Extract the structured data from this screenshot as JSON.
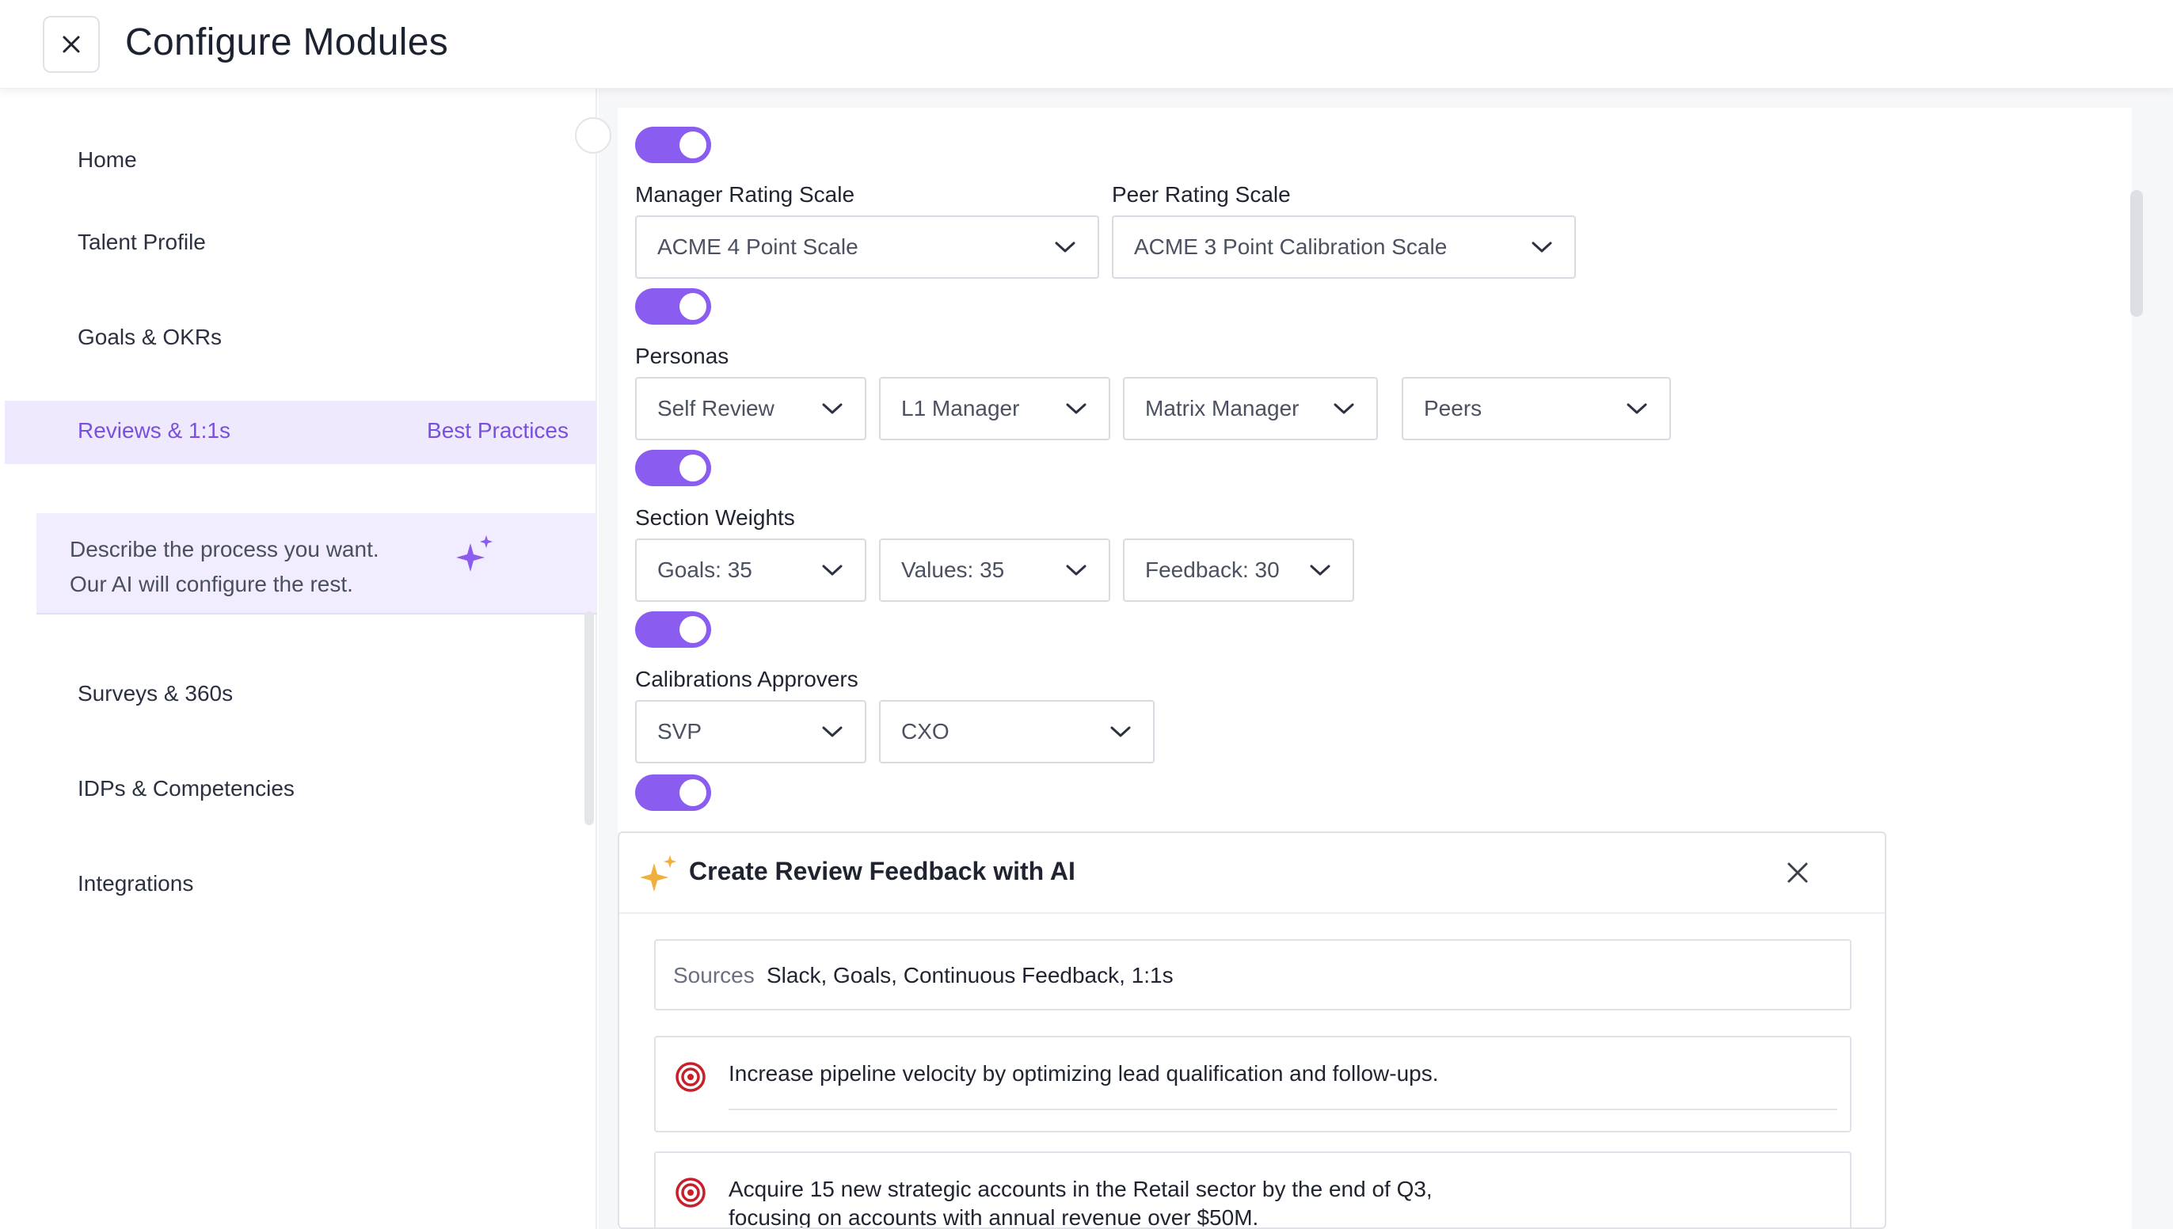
{
  "header": {
    "title": "Configure Modules"
  },
  "sidebar": {
    "items": [
      {
        "label": "Home"
      },
      {
        "label": "Talent Profile"
      },
      {
        "label": "Goals & OKRs"
      },
      {
        "label": "Reviews & 1:1s",
        "extra": "Best Practices"
      },
      {
        "label": "Surveys & 360s"
      },
      {
        "label": "IDPs & Competencies"
      },
      {
        "label": "Integrations"
      }
    ],
    "ai_prompt": {
      "line1": "Describe the process you want.",
      "line2": "Our AI will configure the rest."
    }
  },
  "settings": {
    "manager_rating": {
      "label": "Manager Rating Scale",
      "value": "ACME 4 Point Scale"
    },
    "peer_rating": {
      "label": "Peer Rating Scale",
      "value": "ACME 3 Point Calibration Scale"
    },
    "personas": {
      "label": "Personas",
      "values": [
        "Self Review",
        "L1 Manager",
        "Matrix Manager",
        "Peers"
      ]
    },
    "section_weights": {
      "label": "Section Weights",
      "values": [
        "Goals: 35",
        "Values: 35",
        "Feedback: 30"
      ]
    },
    "approvers": {
      "label": "Calibrations Approvers",
      "values": [
        "SVP",
        "CXO"
      ]
    }
  },
  "ai_feedback": {
    "title": "Create Review Feedback with AI",
    "sources_label": "Sources",
    "sources_value": "Slack, Goals, Continuous Feedback, 1:1s",
    "goals": [
      "Increase pipeline velocity by optimizing lead qualification and follow-ups.",
      "Acquire 15 new strategic accounts in the Retail sector by the end of Q3,",
      "focusing on accounts with annual revenue over $50M."
    ]
  },
  "colors": {
    "accent": "#8a5cf0",
    "active_bg": "#efe9fd",
    "target": "#c8202a",
    "spark_gold": "#f0b03c"
  }
}
